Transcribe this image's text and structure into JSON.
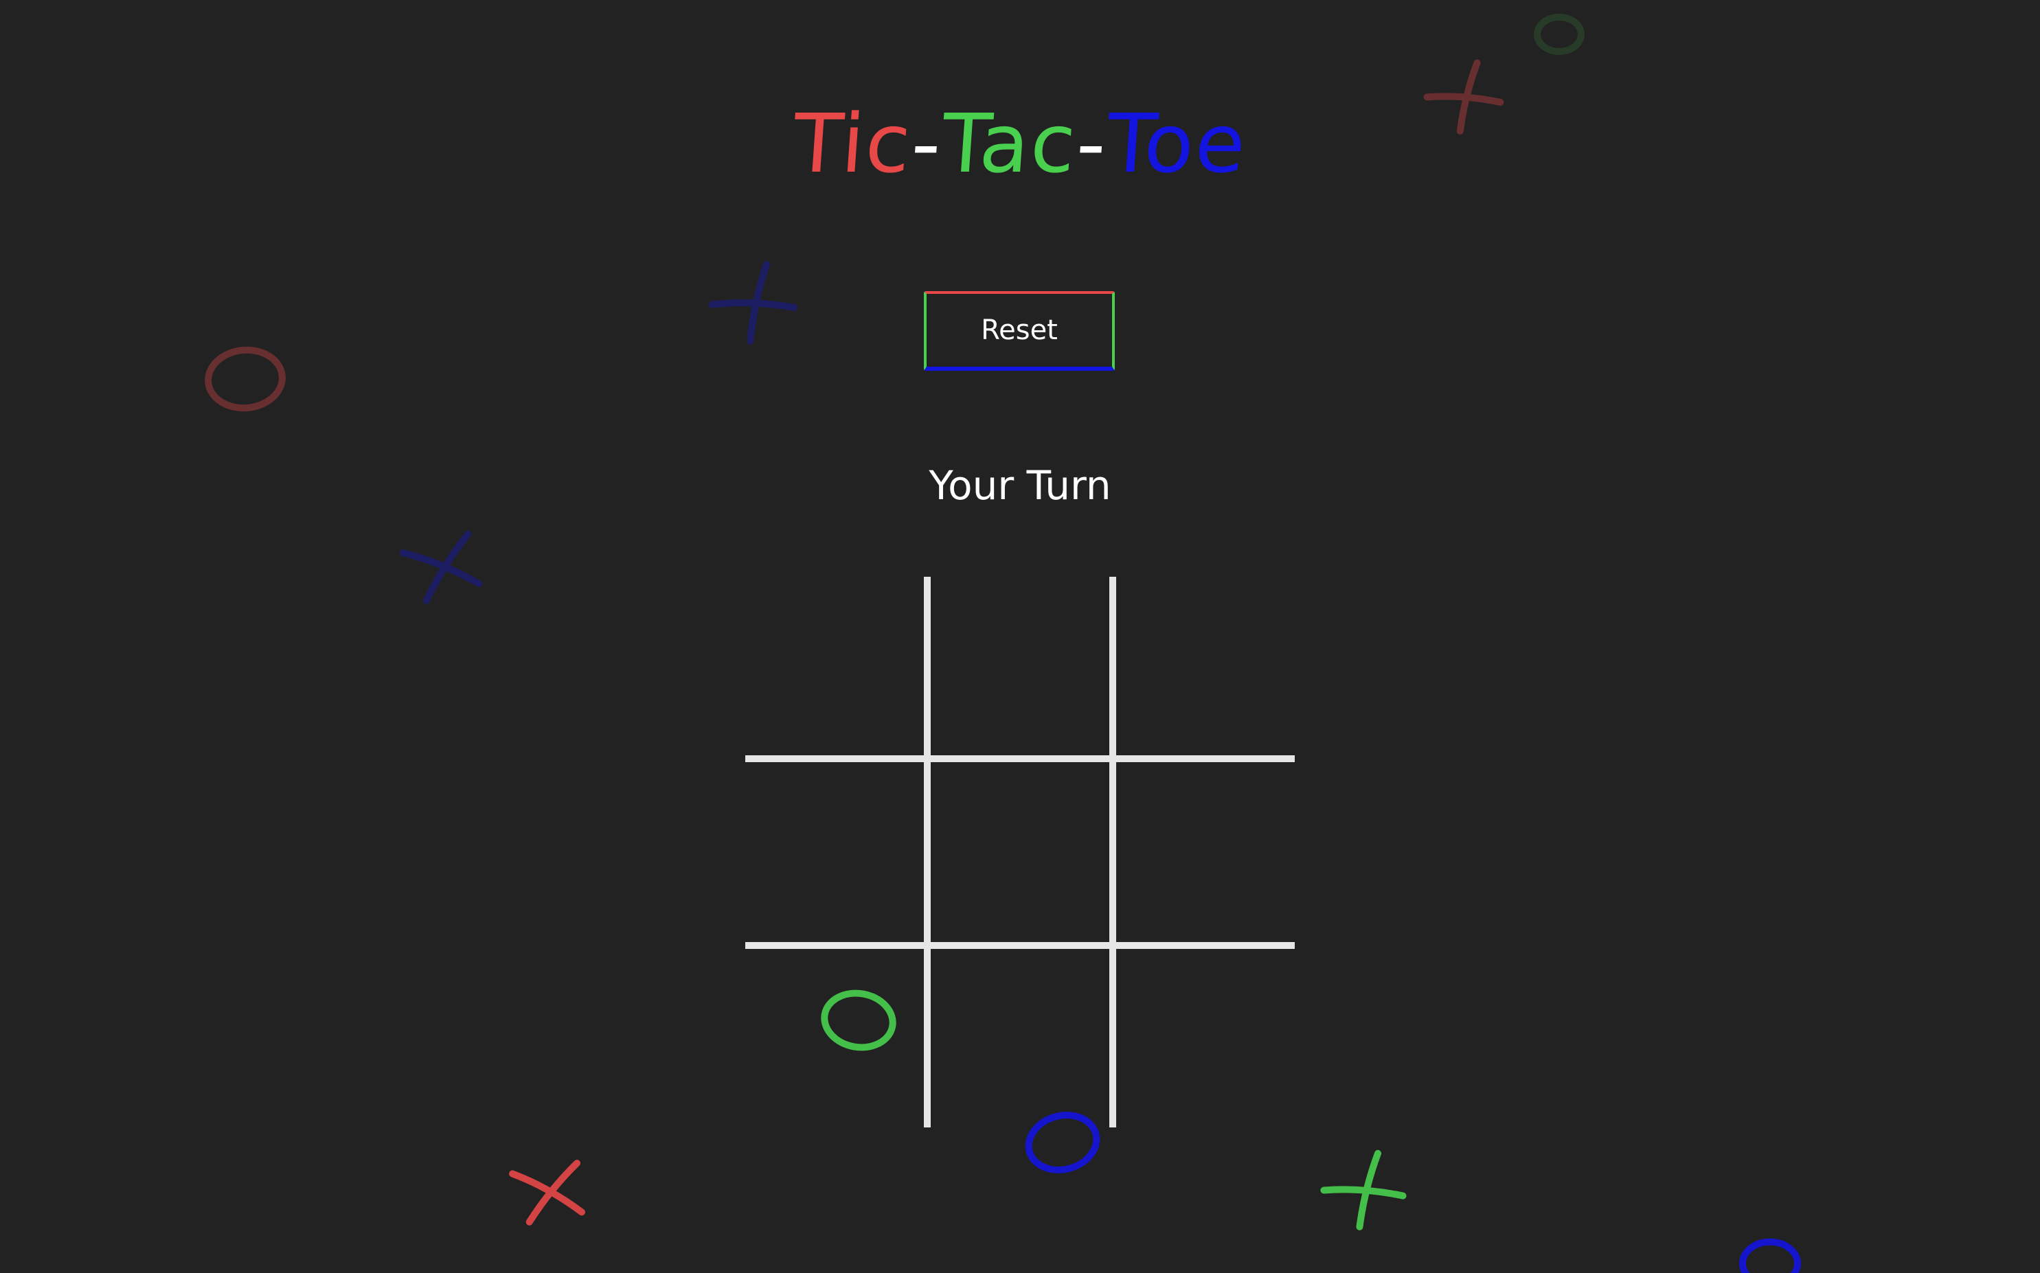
{
  "title": {
    "part1": "Tic",
    "dash1": "-",
    "part2": "Tac",
    "dash2": "-",
    "part3": "Toe"
  },
  "colors": {
    "background": "#222222",
    "red": "#e84848",
    "green": "#48d04e",
    "blue": "#1414e0",
    "grid": "#e6e6e6",
    "text": "#ffffff"
  },
  "reset_label": "Reset",
  "status_text": "Your Turn",
  "board": {
    "cells": [
      "",
      "",
      "",
      "",
      "",
      "",
      "",
      "",
      ""
    ]
  },
  "background_marks": [
    {
      "mark": "x",
      "color": "red",
      "faded": true
    },
    {
      "mark": "o",
      "color": "green",
      "faded": true
    },
    {
      "mark": "x",
      "color": "blue",
      "faded": true
    },
    {
      "mark": "o",
      "color": "red",
      "faded": true
    },
    {
      "mark": "x",
      "color": "blue",
      "faded": true
    },
    {
      "mark": "o",
      "color": "green",
      "faded": false
    },
    {
      "mark": "o",
      "color": "blue",
      "faded": false
    },
    {
      "mark": "x",
      "color": "red",
      "faded": false
    },
    {
      "mark": "x",
      "color": "green",
      "faded": false
    },
    {
      "mark": "o",
      "color": "blue",
      "faded": false
    }
  ]
}
